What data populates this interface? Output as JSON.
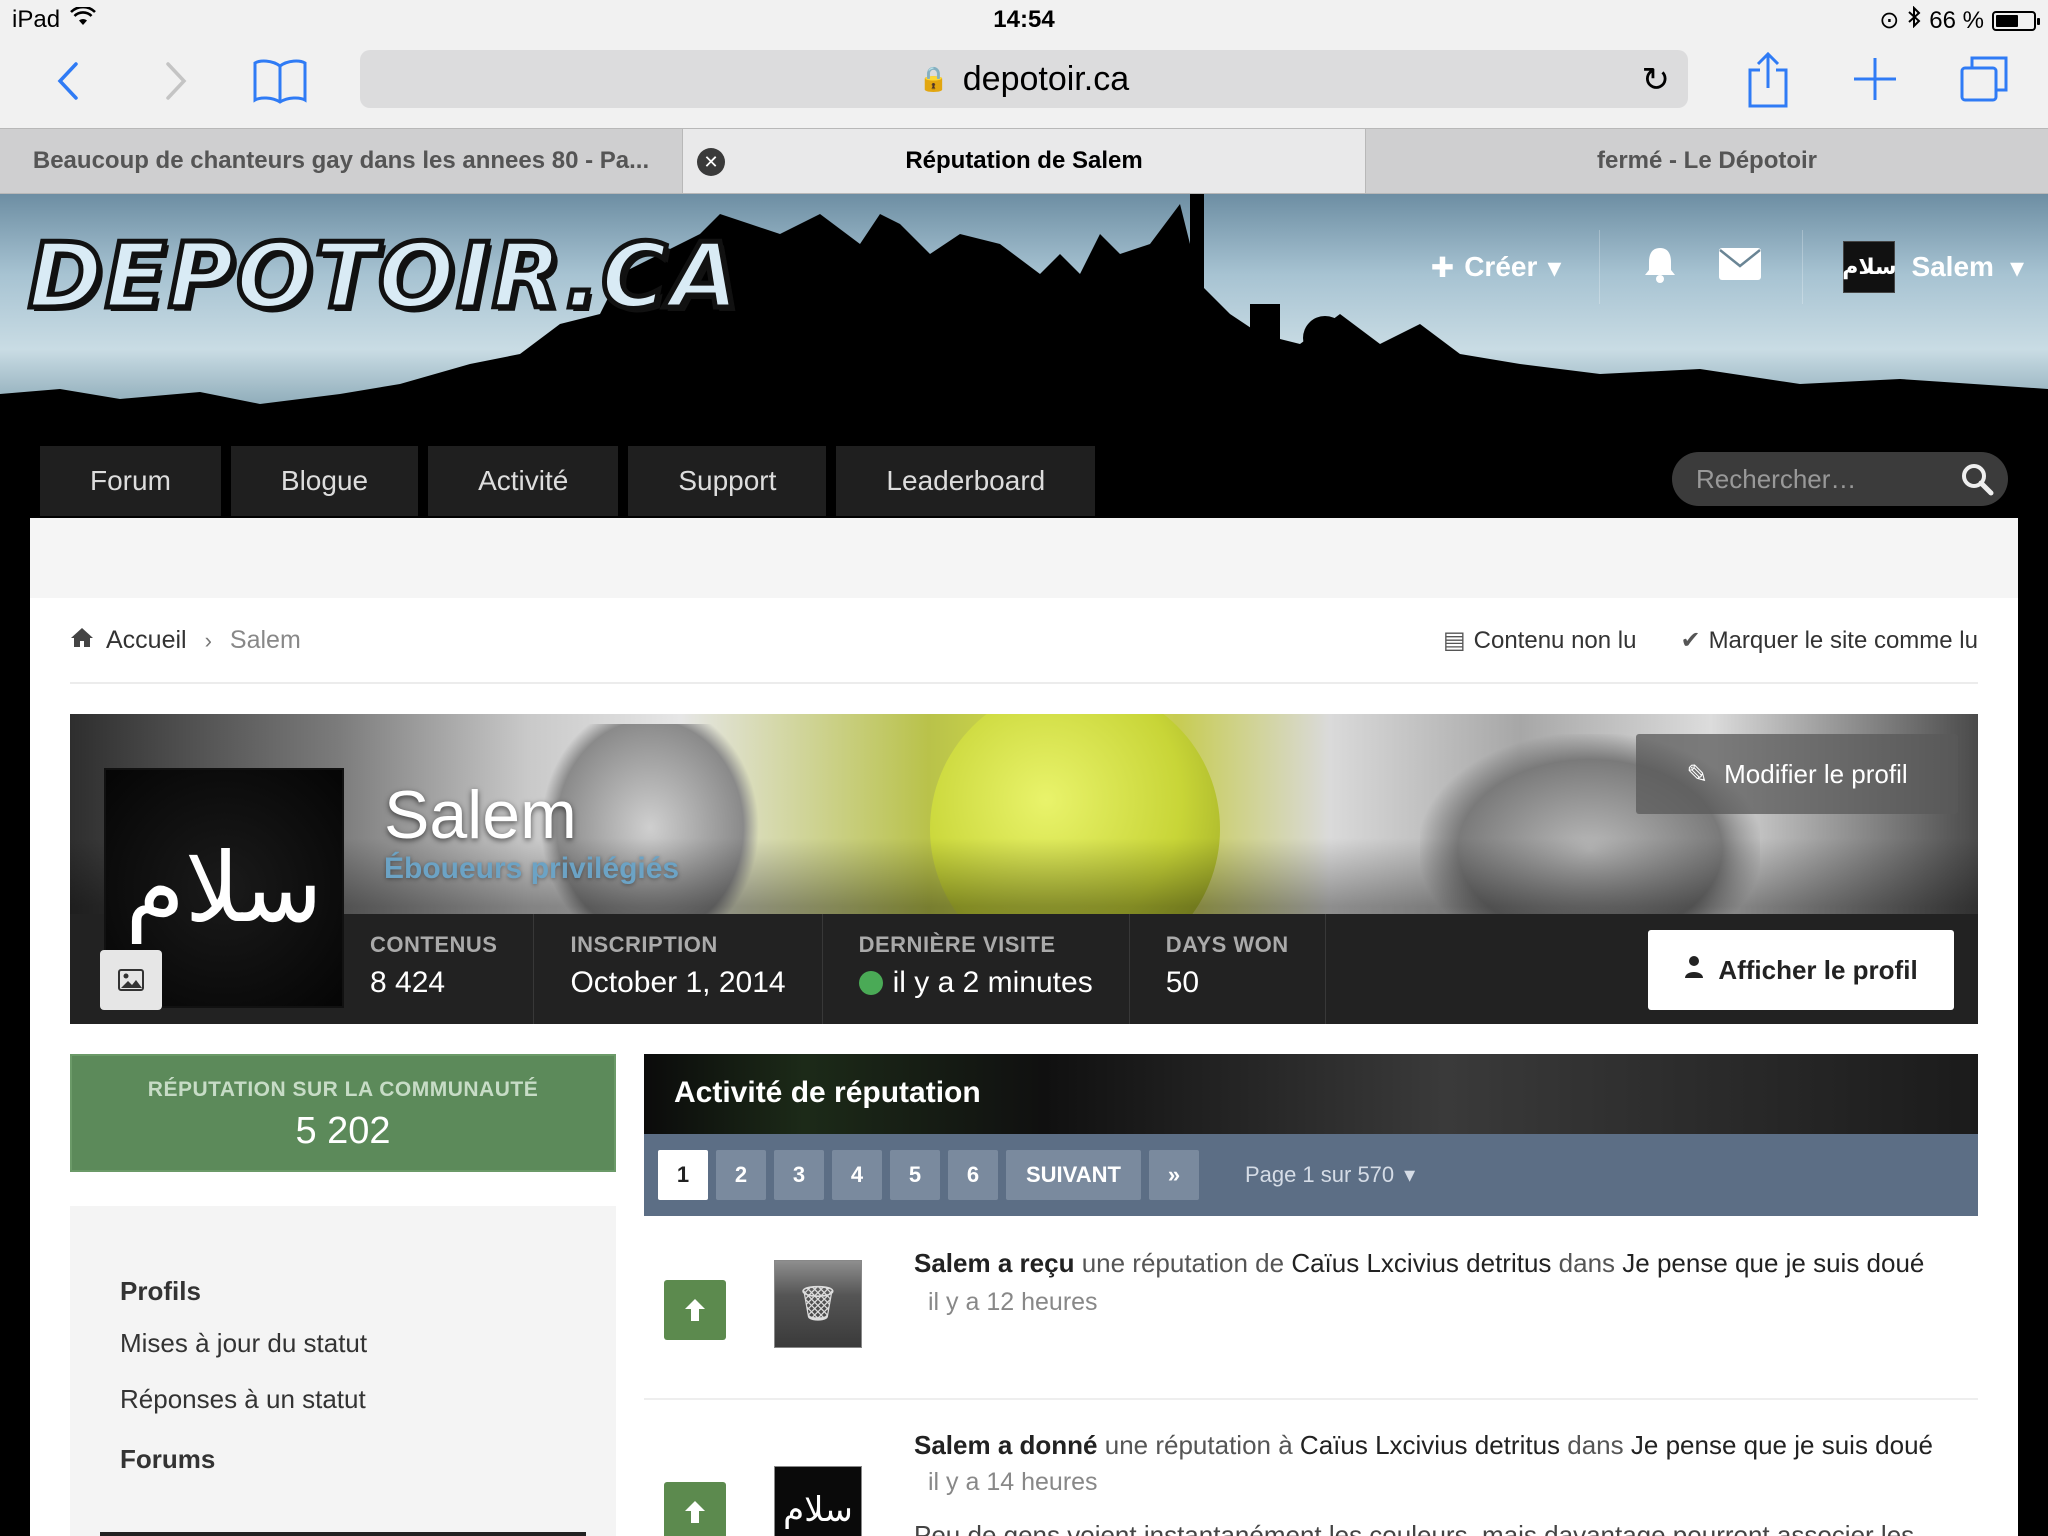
{
  "status_bar": {
    "device": "iPad",
    "time": "14:54",
    "battery_text": "66 %",
    "battery_level": 0.66
  },
  "browser": {
    "url": "depotoir.ca",
    "tabs": [
      {
        "label": "Beaucoup de chanteurs gay dans les annees 80 - Pa...",
        "active": false
      },
      {
        "label": "Réputation de Salem",
        "active": true
      },
      {
        "label": "fermé - Le Dépotoir",
        "active": false
      }
    ]
  },
  "site": {
    "logo_text": "DEPOTOIR.CA",
    "create_label": "Créer",
    "username": "Salem",
    "nav": [
      "Forum",
      "Blogue",
      "Activité",
      "Support",
      "Leaderboard"
    ],
    "search_placeholder": "Rechercher…"
  },
  "breadcrumb": {
    "home": "Accueil",
    "current": "Salem"
  },
  "top_actions": {
    "unread": "Contenu non lu",
    "mark_read": "Marquer le site comme lu"
  },
  "profile": {
    "avatar_text": "سلام",
    "name": "Salem",
    "group": "Éboueurs privilégiés",
    "edit_label": "Modifier le profil",
    "view_label": "Afficher le profil",
    "stats": [
      {
        "label": "CONTENUS",
        "value": "8 424"
      },
      {
        "label": "INSCRIPTION",
        "value": "October 1, 2014"
      },
      {
        "label": "DERNIÈRE VISITE",
        "value": "il y a 2 minutes"
      },
      {
        "label": "DAYS WON",
        "value": "50"
      }
    ]
  },
  "reputation": {
    "label": "RÉPUTATION SUR LA COMMUNAUTÉ",
    "value": "5 202"
  },
  "side_menu": {
    "profiles_head": "Profils",
    "items": [
      "Mises à jour du statut",
      "Réponses à un statut"
    ],
    "forums_head": "Forums"
  },
  "activity": {
    "title": "Activité de réputation",
    "pages": [
      "1",
      "2",
      "3",
      "4",
      "5",
      "6"
    ],
    "next_label": "SUIVANT",
    "last_label": "»",
    "page_info": "Page 1 sur 570",
    "rows": [
      {
        "user": "Salem",
        "action": "a reçu",
        "mid": "une réputation de",
        "other": "Caïus Lxcivius detritus",
        "in": "dans",
        "topic": "Je pense que je suis doué",
        "time": "il y a 12 heures"
      },
      {
        "user": "Salem",
        "action": "a donné",
        "mid": "une réputation à",
        "other": "Caïus Lxcivius detritus",
        "in": "dans",
        "topic": "Je pense que je suis doué",
        "time": "il y a 14 heures",
        "snippet": "Peu de gens voient instantanément les couleurs, mais davantage pourront associer les"
      }
    ]
  }
}
